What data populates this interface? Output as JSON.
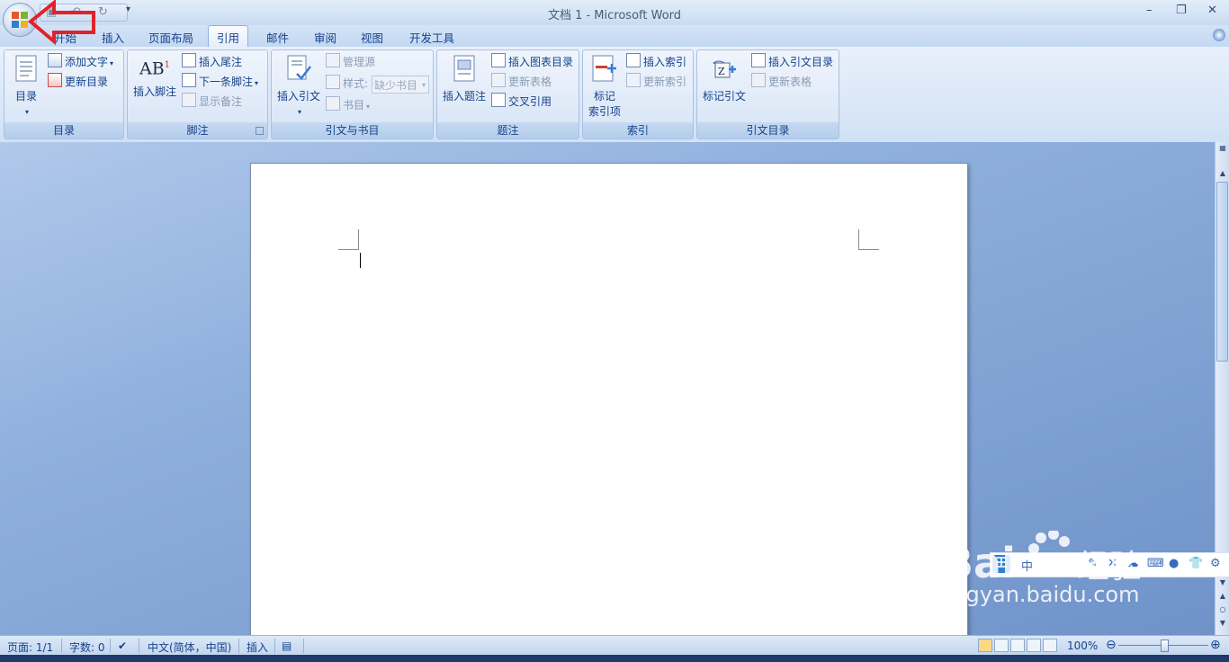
{
  "window": {
    "title": "文档 1 - Microsoft Word"
  },
  "quick_access": {
    "icons": [
      "save-icon",
      "undo-icon",
      "redo-icon"
    ],
    "more": "▾"
  },
  "window_controls": {
    "minimize": "–",
    "restore": "❐",
    "close": "✕"
  },
  "tabs": [
    "开始",
    "插入",
    "页面布局",
    "引用",
    "邮件",
    "审阅",
    "视图",
    "开发工具"
  ],
  "active_tab": "引用",
  "ribbon": {
    "toc": {
      "label": "目录",
      "big_label": "目录",
      "add_text": "添加文字",
      "update_toc": "更新目录"
    },
    "footnotes": {
      "label": "脚注",
      "insert_footnote": "插入脚注",
      "insert_endnote": "插入尾注",
      "next_footnote": "下一条脚注",
      "show_notes": "显示备注"
    },
    "citations": {
      "label": "引文与书目",
      "insert_citation": "插入引文",
      "manage_sources": "管理源",
      "style_label": "样式:",
      "style_value": "缺少书目",
      "bibliography": "书目"
    },
    "captions": {
      "label": "题注",
      "insert_caption": "插入题注",
      "insert_table_of_figures": "插入图表目录",
      "update_table": "更新表格",
      "cross_reference": "交叉引用"
    },
    "index": {
      "label": "索引",
      "mark_entry_line1": "标记",
      "mark_entry_line2": "索引项",
      "insert_index": "插入索引",
      "update_index": "更新索引"
    },
    "authorities": {
      "label": "引文目录",
      "mark_citation": "标记引文",
      "insert_table_of_authorities": "插入引文目录",
      "update_table": "更新表格"
    }
  },
  "statusbar": {
    "page": "页面: 1/1",
    "words": "字数: 0",
    "language": "中文(简体，中国)",
    "mode": "插入",
    "zoom": "100%"
  },
  "ime": {
    "logo": "王",
    "mode": "中"
  },
  "watermark": {
    "url": "jingyan.baidu.com"
  },
  "colors": {
    "ribbon_text": "#15428b",
    "arrow": "#e0232b",
    "page": "#ffffff"
  }
}
